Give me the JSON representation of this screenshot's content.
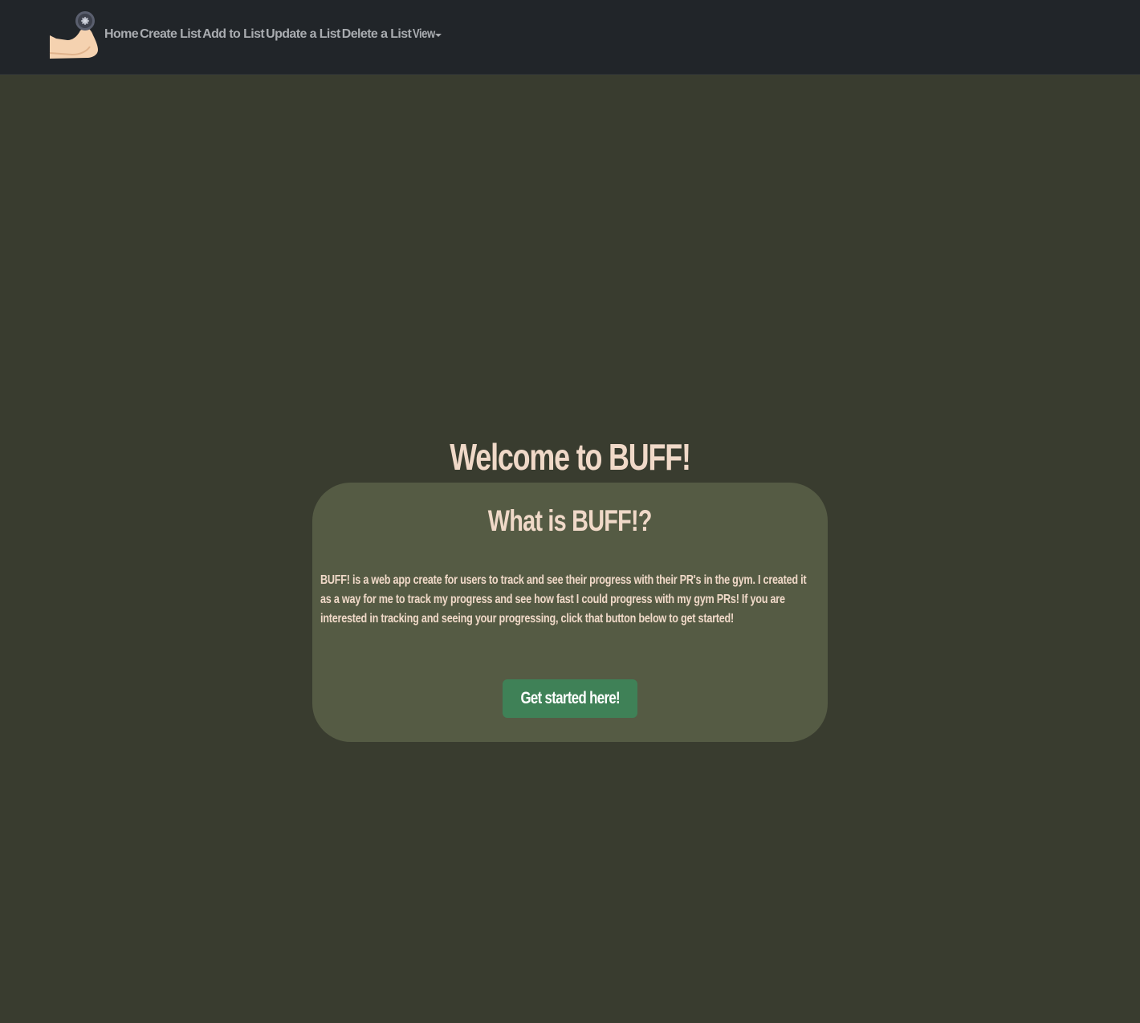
{
  "nav": {
    "logo_icon": "flexed-arm-dumbbell-icon",
    "items": [
      {
        "label": "Home"
      },
      {
        "label": "Create List"
      },
      {
        "label": "Add to List"
      },
      {
        "label": "Update a List"
      },
      {
        "label": "Delete a List"
      }
    ],
    "dropdown": {
      "label": "View",
      "icon": "caret-down-icon"
    }
  },
  "hero": {
    "title": "Welcome to BUFF!"
  },
  "card": {
    "title": "What is BUFF!?",
    "body": "BUFF! is a web app create for users to track and see their progress with their PR's in the gym. I created it as a way for me to track my progress and see how fast I could progress with my gym PRs! If you are interested in tracking and seeing your progressing, click that button below to get started!",
    "button_label": "Get started here!"
  },
  "colors": {
    "navbar_bg": "#212529",
    "page_bg": "#393c2f",
    "card_bg": "#555b44",
    "text_cream": "#f0d9c8",
    "button_green": "#3f8157",
    "nav_link": "#a9acb0"
  }
}
